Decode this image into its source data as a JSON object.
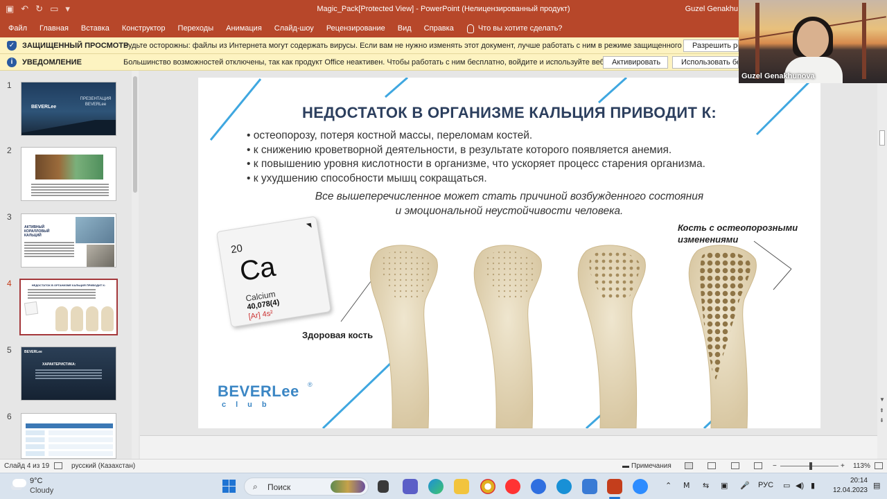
{
  "window": {
    "title": "Magic_Pack[Protected View]  -  PowerPoint (Нелицензированный продукт)",
    "user": "Guzel Genakhu"
  },
  "ribbon": {
    "tabs": [
      "Файл",
      "Главная",
      "Вставка",
      "Конструктор",
      "Переходы",
      "Анимация",
      "Слайд-шоу",
      "Рецензирование",
      "Вид",
      "Справка"
    ],
    "tell_me": "Что вы хотите сделать?"
  },
  "protected_bar": {
    "heading": "ЗАЩИЩЕННЫЙ ПРОСМОТР",
    "text": "Будьте осторожны: файлы из Интернета могут содержать вирусы. Если вам не нужно изменять этот документ, лучше работать с ним в режиме защищенного просмотра.",
    "button": "Разрешить реда"
  },
  "notice_bar": {
    "heading": "УВЕДОМЛЕНИЕ",
    "text": "Большинство возможностей отключены, так как продукт Office неактивен. Чтобы работать с ним бесплатно, войдите и используйте веб-версию.",
    "activate_button": "Активировать",
    "use_button": "Использовать бес"
  },
  "thumbnails": {
    "numbers": [
      "1",
      "2",
      "3",
      "4",
      "5",
      "6"
    ],
    "t1_logo": "BEVERLee",
    "t1_text": "ПРЕЗЕНТАЦИЯ BEVERLee",
    "t3_title": "АКТИВНЫЙ КОРАЛЛОВЫЙ КАЛЬЦИЙ",
    "t4_title": "НЕДОСТАТОК В ОРГАНИЗМЕ КАЛЬЦИЯ ПРИВОДИТ К:",
    "t5_title": "ХАРАКТЕРИСТИКА:"
  },
  "slide": {
    "title": "НЕДОСТАТОК В ОРГАНИЗМЕ КАЛЬЦИЯ ПРИВОДИТ К:",
    "bullets": [
      "остеопорозу, потеря костной массы, переломам костей.",
      "к снижению кроветворной деятельности, в результате которого появляется анемия.",
      "к повышению уровня кислотности в организме, что ускоряет процесс старения организма.",
      "к ухудшению способности мышц сокращаться."
    ],
    "summary_line1": "Все вышеперечисленное может стать причиной возбужденного состояния",
    "summary_line2": "и эмоциональной неустойчивости человека.",
    "element": {
      "number": "20",
      "symbol": "Ca",
      "name": "Calcium",
      "mass": "40,078(4)",
      "config": "[Ar] 4s²"
    },
    "label_healthy": "Здоровая кость",
    "label_osteo_line1": "Кость с остеопорозными",
    "label_osteo_line2": "изменениями",
    "logo": "BEVERLee",
    "logo_sub": "club",
    "logo_reg": "®"
  },
  "status": {
    "slide_of": "Слайд 4 из 19",
    "language": "русский (Казахстан)",
    "notes": "Примечания",
    "zoom": "113%"
  },
  "taskbar": {
    "temp": "9°C",
    "weather": "Cloudy",
    "search": "Поиск",
    "lang": "РУС",
    "time": "20:14",
    "date": "12.04.2023"
  },
  "video": {
    "name": "Guzel Genakhunova"
  },
  "colors": {
    "accent_ppt": "#b7472a",
    "slide_title": "#2c3f5e",
    "stripe_blue": "#3fa7e0",
    "logo_blue": "#3b86c4",
    "message_bar": "#fdf3c1"
  }
}
